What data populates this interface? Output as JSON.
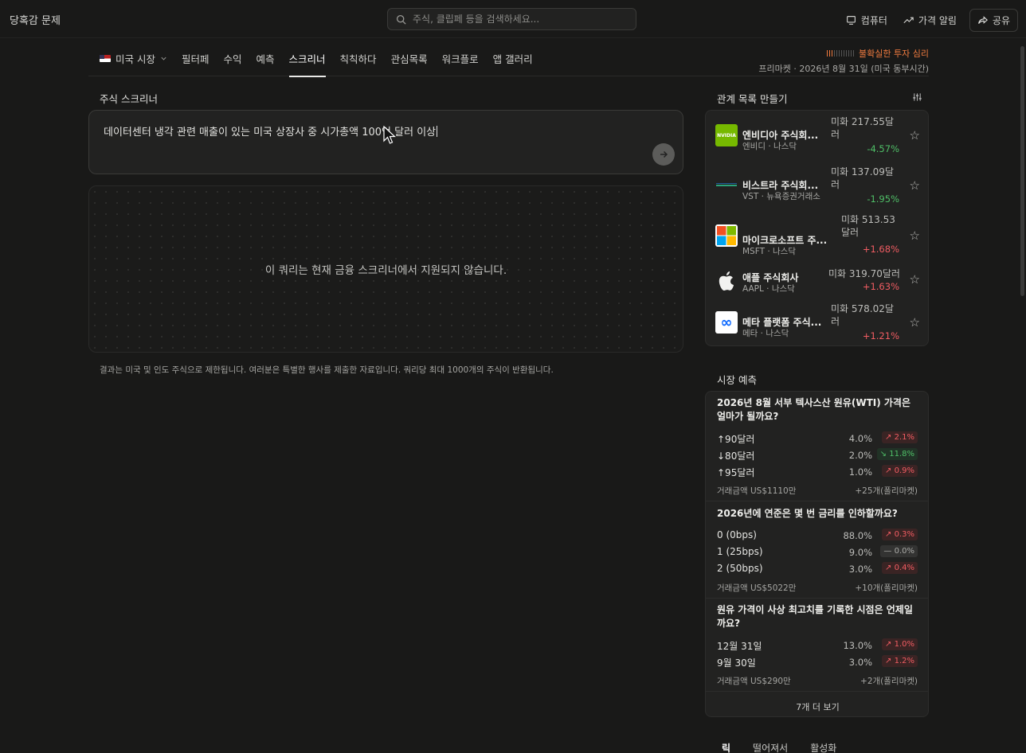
{
  "app": {
    "brand": "당혹감 문제",
    "search_placeholder": "주식, 클립페 등을 검색하세요...",
    "actions": {
      "computer": "컴퓨터",
      "price_alert": "가격 알림",
      "share": "공유"
    }
  },
  "nav": {
    "market": "미국 시장",
    "tabs": [
      "필터페",
      "수익",
      "예측",
      "스크리너",
      "칙칙하다",
      "관심목록",
      "워크플로",
      "앱 갤러리"
    ],
    "active_tab": "스크리너",
    "sentiment_label": "불확실한 투자 심리",
    "sentiment_level": 0.25,
    "market_time": "프리마켓  ·  2026년 8월 31일 (미국 동부시간)"
  },
  "screener": {
    "title": "주식 스크리너",
    "query": "데이터센터 냉각 관련 매출이 있는 미국 상장사 중 시가총액 100억 달러 이상",
    "result_message": "이 쿼리는 현재 금융 스크리너에서 지원되지 않습니다.",
    "disclaimer": "결과는 미국 및 인도 주식으로 제한됩니다. 여러분은 특별한 행사를 제출한 자료입니다. 쿼리당 최대 1000개의 주식이 반환됩니다."
  },
  "watchlist": {
    "title": "관계 목록 만들기",
    "items": [
      {
        "name": "엔비디아 주식회...",
        "sub": "엔비디  ·  나스닥",
        "price": "미화 217.55달러",
        "change": "-4.57%",
        "dir": "down",
        "logo": "nvidia",
        "logo_text": "NVIDIA"
      },
      {
        "name": "비스트라 주식회...",
        "sub": "VST  ·  뉴욕증권거래소",
        "price": "미화 137.09달러",
        "change": "-1.95%",
        "dir": "down",
        "logo": "vistra",
        "logo_text": ""
      },
      {
        "name": "마이크로소프트 주...",
        "sub": "MSFT  ·  나스닥",
        "price": "미화 513.53달러",
        "change": "+1.68%",
        "dir": "up",
        "logo": "microsoft",
        "logo_text": ""
      },
      {
        "name": "애플 주식회사",
        "sub": "AAPL  ·  나스닥",
        "price": "미화 319.70달러",
        "change": "+1.63%",
        "dir": "up",
        "logo": "apple",
        "logo_text": ""
      },
      {
        "name": "메타 플랫폼 주식...",
        "sub": "메타  ·  나스닥",
        "price": "미화 578.02달러",
        "change": "+1.21%",
        "dir": "up",
        "logo": "meta",
        "logo_text": "∞"
      }
    ]
  },
  "predictions": {
    "title": "시장 예측",
    "markets": [
      {
        "question": "2026년 8월 서부 텍사스산 원유(WTI) 가격은 얼마가 될까요?",
        "options": [
          {
            "label": "↑90달러",
            "pct": "4.0%",
            "chg": "↗ 2.1%",
            "dir": "up"
          },
          {
            "label": "↓80달러",
            "pct": "2.0%",
            "chg": "↘ 11.8%",
            "dir": "down"
          },
          {
            "label": "↑95달러",
            "pct": "1.0%",
            "chg": "↗ 0.9%",
            "dir": "up"
          }
        ],
        "volume": "거래금액 US$1110만",
        "more": "+25개(폴리마켓)"
      },
      {
        "question": "2026년에 연준은 몇 번 금리를 인하할까요?",
        "options": [
          {
            "label": "0 (0bps)",
            "pct": "88.0%",
            "chg": "↗ 0.3%",
            "dir": "up"
          },
          {
            "label": "1 (25bps)",
            "pct": "9.0%",
            "chg": "— 0.0%",
            "dir": "flat"
          },
          {
            "label": "2 (50bps)",
            "pct": "3.0%",
            "chg": "↗ 0.4%",
            "dir": "up"
          }
        ],
        "volume": "거래금액 US$5022만",
        "more": "+10개(폴리마켓)"
      },
      {
        "question": "원유 가격이 사상 최고치를 기록한 시점은 언제일까요?",
        "options": [
          {
            "label": "12월 31일",
            "pct": "13.0%",
            "chg": "↗ 1.0%",
            "dir": "up"
          },
          {
            "label": "9월 30일",
            "pct": "3.0%",
            "chg": "↗ 1.2%",
            "dir": "up"
          }
        ],
        "volume": "거래금액 US$290만",
        "more": "+2개(폴리마켓)"
      }
    ],
    "see_more": "7개 더 보기"
  },
  "bottom_tabs": [
    "릭",
    "떨어져서",
    "활성화"
  ],
  "colors": {
    "up": "#f05c62",
    "down": "#4fbf67",
    "sentiment": "#f07b3f",
    "background": "#191918"
  }
}
